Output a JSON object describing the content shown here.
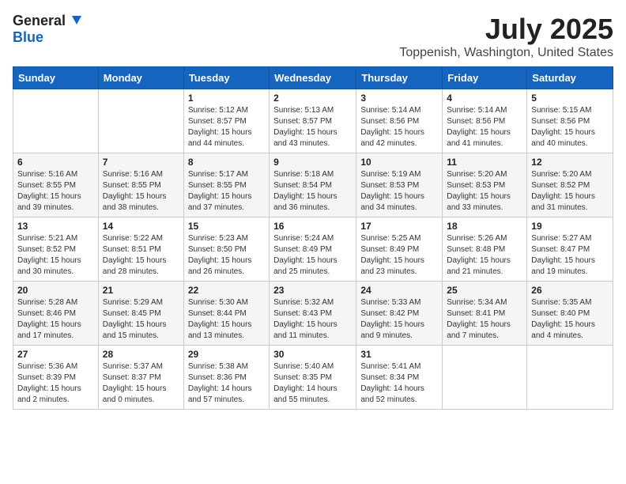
{
  "header": {
    "logo_general": "General",
    "logo_blue": "Blue",
    "month": "July 2025",
    "location": "Toppenish, Washington, United States"
  },
  "weekdays": [
    "Sunday",
    "Monday",
    "Tuesday",
    "Wednesday",
    "Thursday",
    "Friday",
    "Saturday"
  ],
  "weeks": [
    [
      {
        "day": "",
        "sunrise": "",
        "sunset": "",
        "daylight": ""
      },
      {
        "day": "",
        "sunrise": "",
        "sunset": "",
        "daylight": ""
      },
      {
        "day": "1",
        "sunrise": "Sunrise: 5:12 AM",
        "sunset": "Sunset: 8:57 PM",
        "daylight": "Daylight: 15 hours and 44 minutes."
      },
      {
        "day": "2",
        "sunrise": "Sunrise: 5:13 AM",
        "sunset": "Sunset: 8:57 PM",
        "daylight": "Daylight: 15 hours and 43 minutes."
      },
      {
        "day": "3",
        "sunrise": "Sunrise: 5:14 AM",
        "sunset": "Sunset: 8:56 PM",
        "daylight": "Daylight: 15 hours and 42 minutes."
      },
      {
        "day": "4",
        "sunrise": "Sunrise: 5:14 AM",
        "sunset": "Sunset: 8:56 PM",
        "daylight": "Daylight: 15 hours and 41 minutes."
      },
      {
        "day": "5",
        "sunrise": "Sunrise: 5:15 AM",
        "sunset": "Sunset: 8:56 PM",
        "daylight": "Daylight: 15 hours and 40 minutes."
      }
    ],
    [
      {
        "day": "6",
        "sunrise": "Sunrise: 5:16 AM",
        "sunset": "Sunset: 8:55 PM",
        "daylight": "Daylight: 15 hours and 39 minutes."
      },
      {
        "day": "7",
        "sunrise": "Sunrise: 5:16 AM",
        "sunset": "Sunset: 8:55 PM",
        "daylight": "Daylight: 15 hours and 38 minutes."
      },
      {
        "day": "8",
        "sunrise": "Sunrise: 5:17 AM",
        "sunset": "Sunset: 8:55 PM",
        "daylight": "Daylight: 15 hours and 37 minutes."
      },
      {
        "day": "9",
        "sunrise": "Sunrise: 5:18 AM",
        "sunset": "Sunset: 8:54 PM",
        "daylight": "Daylight: 15 hours and 36 minutes."
      },
      {
        "day": "10",
        "sunrise": "Sunrise: 5:19 AM",
        "sunset": "Sunset: 8:53 PM",
        "daylight": "Daylight: 15 hours and 34 minutes."
      },
      {
        "day": "11",
        "sunrise": "Sunrise: 5:20 AM",
        "sunset": "Sunset: 8:53 PM",
        "daylight": "Daylight: 15 hours and 33 minutes."
      },
      {
        "day": "12",
        "sunrise": "Sunrise: 5:20 AM",
        "sunset": "Sunset: 8:52 PM",
        "daylight": "Daylight: 15 hours and 31 minutes."
      }
    ],
    [
      {
        "day": "13",
        "sunrise": "Sunrise: 5:21 AM",
        "sunset": "Sunset: 8:52 PM",
        "daylight": "Daylight: 15 hours and 30 minutes."
      },
      {
        "day": "14",
        "sunrise": "Sunrise: 5:22 AM",
        "sunset": "Sunset: 8:51 PM",
        "daylight": "Daylight: 15 hours and 28 minutes."
      },
      {
        "day": "15",
        "sunrise": "Sunrise: 5:23 AM",
        "sunset": "Sunset: 8:50 PM",
        "daylight": "Daylight: 15 hours and 26 minutes."
      },
      {
        "day": "16",
        "sunrise": "Sunrise: 5:24 AM",
        "sunset": "Sunset: 8:49 PM",
        "daylight": "Daylight: 15 hours and 25 minutes."
      },
      {
        "day": "17",
        "sunrise": "Sunrise: 5:25 AM",
        "sunset": "Sunset: 8:49 PM",
        "daylight": "Daylight: 15 hours and 23 minutes."
      },
      {
        "day": "18",
        "sunrise": "Sunrise: 5:26 AM",
        "sunset": "Sunset: 8:48 PM",
        "daylight": "Daylight: 15 hours and 21 minutes."
      },
      {
        "day": "19",
        "sunrise": "Sunrise: 5:27 AM",
        "sunset": "Sunset: 8:47 PM",
        "daylight": "Daylight: 15 hours and 19 minutes."
      }
    ],
    [
      {
        "day": "20",
        "sunrise": "Sunrise: 5:28 AM",
        "sunset": "Sunset: 8:46 PM",
        "daylight": "Daylight: 15 hours and 17 minutes."
      },
      {
        "day": "21",
        "sunrise": "Sunrise: 5:29 AM",
        "sunset": "Sunset: 8:45 PM",
        "daylight": "Daylight: 15 hours and 15 minutes."
      },
      {
        "day": "22",
        "sunrise": "Sunrise: 5:30 AM",
        "sunset": "Sunset: 8:44 PM",
        "daylight": "Daylight: 15 hours and 13 minutes."
      },
      {
        "day": "23",
        "sunrise": "Sunrise: 5:32 AM",
        "sunset": "Sunset: 8:43 PM",
        "daylight": "Daylight: 15 hours and 11 minutes."
      },
      {
        "day": "24",
        "sunrise": "Sunrise: 5:33 AM",
        "sunset": "Sunset: 8:42 PM",
        "daylight": "Daylight: 15 hours and 9 minutes."
      },
      {
        "day": "25",
        "sunrise": "Sunrise: 5:34 AM",
        "sunset": "Sunset: 8:41 PM",
        "daylight": "Daylight: 15 hours and 7 minutes."
      },
      {
        "day": "26",
        "sunrise": "Sunrise: 5:35 AM",
        "sunset": "Sunset: 8:40 PM",
        "daylight": "Daylight: 15 hours and 4 minutes."
      }
    ],
    [
      {
        "day": "27",
        "sunrise": "Sunrise: 5:36 AM",
        "sunset": "Sunset: 8:39 PM",
        "daylight": "Daylight: 15 hours and 2 minutes."
      },
      {
        "day": "28",
        "sunrise": "Sunrise: 5:37 AM",
        "sunset": "Sunset: 8:37 PM",
        "daylight": "Daylight: 15 hours and 0 minutes."
      },
      {
        "day": "29",
        "sunrise": "Sunrise: 5:38 AM",
        "sunset": "Sunset: 8:36 PM",
        "daylight": "Daylight: 14 hours and 57 minutes."
      },
      {
        "day": "30",
        "sunrise": "Sunrise: 5:40 AM",
        "sunset": "Sunset: 8:35 PM",
        "daylight": "Daylight: 14 hours and 55 minutes."
      },
      {
        "day": "31",
        "sunrise": "Sunrise: 5:41 AM",
        "sunset": "Sunset: 8:34 PM",
        "daylight": "Daylight: 14 hours and 52 minutes."
      },
      {
        "day": "",
        "sunrise": "",
        "sunset": "",
        "daylight": ""
      },
      {
        "day": "",
        "sunrise": "",
        "sunset": "",
        "daylight": ""
      }
    ]
  ]
}
